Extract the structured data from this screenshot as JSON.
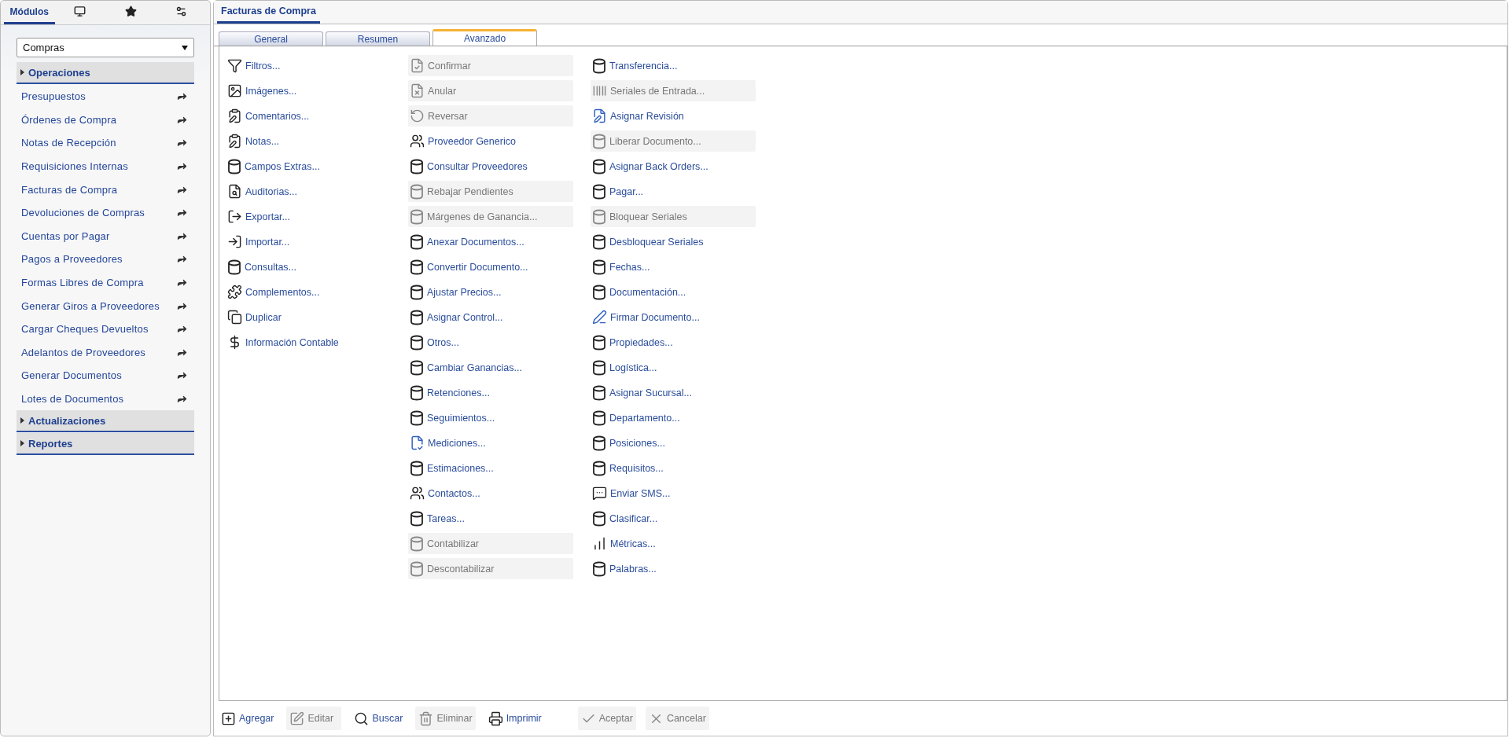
{
  "sidebar": {
    "tabs": [
      {
        "kind": "text",
        "label": "Módulos",
        "selected": true
      },
      {
        "kind": "monitor",
        "selected": false
      },
      {
        "kind": "star",
        "selected": false
      },
      {
        "kind": "gears",
        "selected": false
      }
    ],
    "module_select": {
      "value": "Compras"
    },
    "sections": [
      {
        "label": "Operaciones",
        "items": [
          "Presupuestos",
          "Órdenes de Compra",
          "Notas de Recepción",
          "Requisiciones Internas",
          "Facturas de Compra",
          "Devoluciones de Compras",
          "Cuentas por Pagar",
          "Pagos a Proveedores",
          "Formas Libres de Compra",
          "Generar Giros a Proveedores",
          "Cargar Cheques Devueltos",
          "Adelantos de Proveedores",
          "Generar Documentos",
          "Lotes de Documentos"
        ]
      },
      {
        "label": "Actualizaciones"
      },
      {
        "label": "Reportes"
      }
    ]
  },
  "main": {
    "title": "Facturas de Compra",
    "tabs": [
      {
        "label": "General",
        "selected": false
      },
      {
        "label": "Resumen",
        "selected": false
      },
      {
        "label": "Avanzado",
        "selected": true
      }
    ],
    "columns": [
      [
        {
          "kind": "filter",
          "label": "Filtros...",
          "disabled": false
        },
        {
          "kind": "image",
          "label": "Imágenes...",
          "disabled": false
        },
        {
          "kind": "clipboard",
          "label": "Comentarios...",
          "disabled": false
        },
        {
          "kind": "clipboard",
          "label": "Notas...",
          "disabled": false
        },
        {
          "kind": "database",
          "label": "Campos Extras...",
          "disabled": false
        },
        {
          "kind": "audit",
          "label": "Auditorias...",
          "disabled": false
        },
        {
          "kind": "export",
          "label": "Exportar...",
          "disabled": false
        },
        {
          "kind": "import",
          "label": "Importar...",
          "disabled": false
        },
        {
          "kind": "database",
          "label": "Consultas...",
          "disabled": false
        },
        {
          "kind": "puzzle",
          "label": "Complementos...",
          "disabled": false
        },
        {
          "kind": "copy",
          "label": "Duplicar",
          "disabled": false
        },
        {
          "kind": "dollar",
          "label": "Información Contable",
          "disabled": false
        }
      ],
      [
        {
          "kind": "confirm",
          "label": "Confirmar",
          "disabled": true
        },
        {
          "kind": "void",
          "label": "Anular",
          "disabled": true
        },
        {
          "kind": "reverse",
          "label": "Reversar",
          "disabled": true
        },
        {
          "kind": "people",
          "label": "Proveedor Generico",
          "disabled": false
        },
        {
          "kind": "database",
          "label": "Consultar Proveedores",
          "disabled": false
        },
        {
          "kind": "database",
          "label": "Rebajar Pendientes",
          "disabled": true
        },
        {
          "kind": "database",
          "label": "Márgenes de Ganancia...",
          "disabled": true
        },
        {
          "kind": "database",
          "label": "Anexar Documentos...",
          "disabled": false
        },
        {
          "kind": "database",
          "label": "Convertir Documento...",
          "disabled": false
        },
        {
          "kind": "database",
          "label": "Ajustar Precios...",
          "disabled": false
        },
        {
          "kind": "database",
          "label": "Asignar Control...",
          "disabled": false
        },
        {
          "kind": "database",
          "label": "Otros...",
          "disabled": false
        },
        {
          "kind": "database",
          "label": "Cambiar Ganancias...",
          "disabled": false
        },
        {
          "kind": "database",
          "label": "Retenciones...",
          "disabled": false
        },
        {
          "kind": "database",
          "label": "Seguimientos...",
          "disabled": false
        },
        {
          "kind": "measure",
          "label": "Mediciones...",
          "disabled": false
        },
        {
          "kind": "database",
          "label": "Estimaciones...",
          "disabled": false
        },
        {
          "kind": "people",
          "label": "Contactos...",
          "disabled": false
        },
        {
          "kind": "database",
          "label": "Tareas...",
          "disabled": false
        },
        {
          "kind": "database",
          "label": "Contabilizar",
          "disabled": true
        },
        {
          "kind": "database",
          "label": "Descontabilizar",
          "disabled": true
        }
      ],
      [
        {
          "kind": "database",
          "label": "Transferencia...",
          "disabled": false
        },
        {
          "kind": "barcode",
          "label": "Seriales de Entrada...",
          "disabled": true
        },
        {
          "kind": "revision",
          "label": "Asignar Revisión",
          "disabled": false
        },
        {
          "kind": "database",
          "label": "Liberar Documento...",
          "disabled": true
        },
        {
          "kind": "database",
          "label": "Asignar Back Orders...",
          "disabled": false
        },
        {
          "kind": "database",
          "label": "Pagar...",
          "disabled": false
        },
        {
          "kind": "database",
          "label": "Bloquear Seriales",
          "disabled": true
        },
        {
          "kind": "database",
          "label": "Desbloquear Seriales",
          "disabled": false
        },
        {
          "kind": "database",
          "label": "Fechas...",
          "disabled": false
        },
        {
          "kind": "database",
          "label": "Documentación...",
          "disabled": false
        },
        {
          "kind": "pen",
          "label": "Firmar Documento...",
          "disabled": false
        },
        {
          "kind": "database",
          "label": "Propiedades...",
          "disabled": false
        },
        {
          "kind": "database",
          "label": "Logística...",
          "disabled": false
        },
        {
          "kind": "database",
          "label": "Asignar Sucursal...",
          "disabled": false
        },
        {
          "kind": "database",
          "label": "Departamento...",
          "disabled": false
        },
        {
          "kind": "database",
          "label": "Posiciones...",
          "disabled": false
        },
        {
          "kind": "database",
          "label": "Requisitos...",
          "disabled": false
        },
        {
          "kind": "sms",
          "label": "Enviar SMS...",
          "disabled": false
        },
        {
          "kind": "database",
          "label": "Clasificar...",
          "disabled": false
        },
        {
          "kind": "metrics",
          "label": "Métricas...",
          "disabled": false
        },
        {
          "kind": "database",
          "label": "Palabras...",
          "disabled": false
        }
      ]
    ],
    "toolbar": [
      {
        "kind": "add",
        "label": "Agregar",
        "disabled": false
      },
      {
        "kind": "edit",
        "label": "Editar",
        "disabled": true
      },
      {
        "kind": "search",
        "label": "Buscar",
        "disabled": false
      },
      {
        "kind": "delete",
        "label": "Eliminar",
        "disabled": true
      },
      {
        "kind": "print",
        "label": "Imprimir",
        "disabled": false
      },
      {
        "kind": "accept",
        "label": "Aceptar",
        "disabled": true
      },
      {
        "kind": "cancel",
        "label": "Cancelar",
        "disabled": true
      }
    ]
  }
}
